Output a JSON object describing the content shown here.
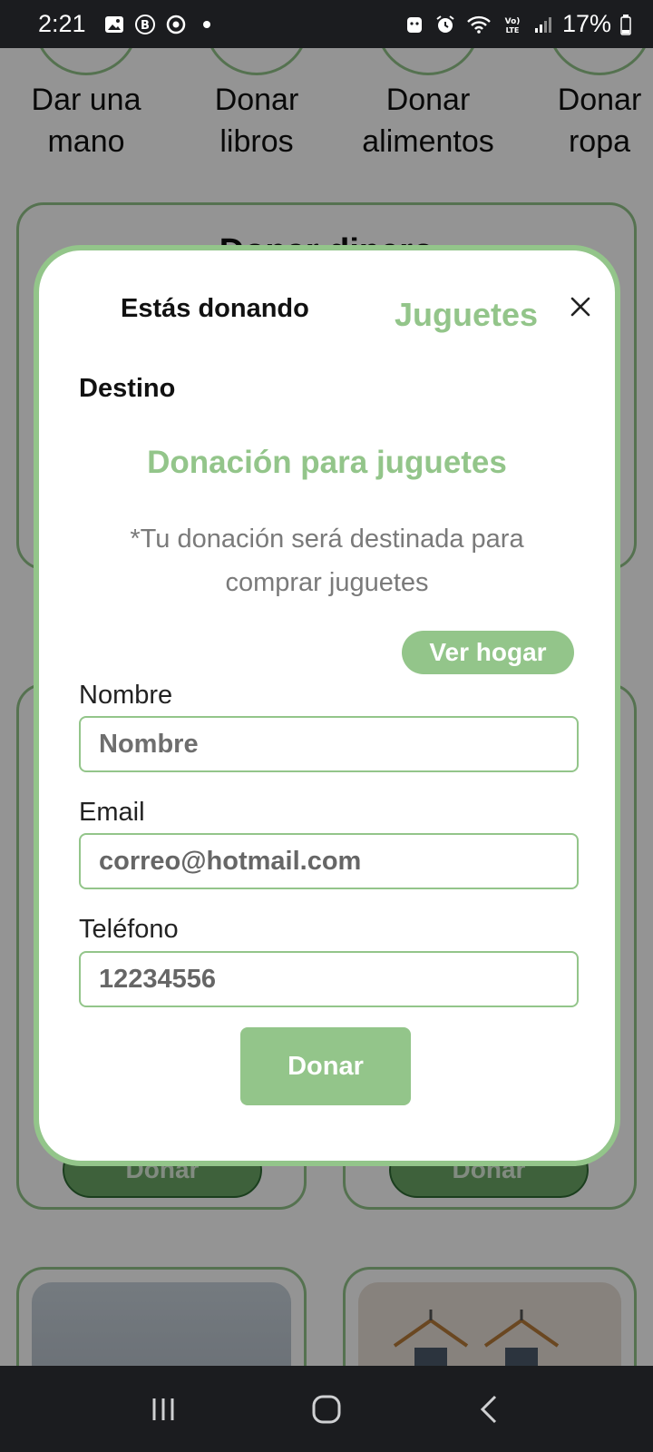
{
  "status_bar": {
    "time": "2:21",
    "battery": "17%",
    "left_icons": [
      "gallery-icon",
      "b-badge-icon",
      "sync-icon",
      "dot-icon"
    ],
    "right_icons": [
      "android-icon",
      "alarm-icon",
      "wifi-icon",
      "volte-icon",
      "signal-icon",
      "battery-icon"
    ]
  },
  "categories": [
    {
      "label": "Dar una mano"
    },
    {
      "label": "Donar libros"
    },
    {
      "label": "Donar alimentos"
    },
    {
      "label": "Donar ropa"
    }
  ],
  "background": {
    "card_title": "Donar dinero",
    "donar_label": "Donar"
  },
  "modal": {
    "title": "Estás donando",
    "category": "Juguetes",
    "destino_label": "Destino",
    "destination_title": "Donación para juguetes",
    "destination_description": "*Tu donación será destinada para comprar juguetes",
    "ver_hogar_label": "Ver hogar",
    "fields": {
      "nombre": {
        "label": "Nombre",
        "placeholder": "Nombre",
        "value": ""
      },
      "email": {
        "label": "Email",
        "placeholder": "",
        "value": "correo@hotmail.com"
      },
      "telefono": {
        "label": "Teléfono",
        "placeholder": "",
        "value": "12234556"
      }
    },
    "submit_label": "Donar"
  },
  "colors": {
    "accent": "#93c58a",
    "dark_green": "#2f6b35",
    "system_bar": "#1b1c1f"
  }
}
